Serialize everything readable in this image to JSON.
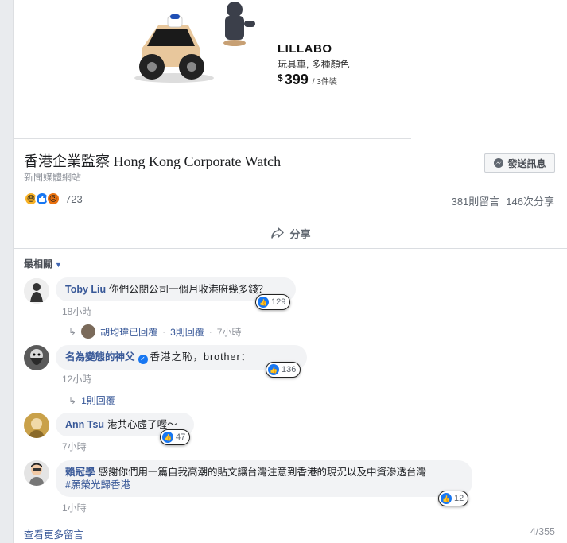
{
  "product": {
    "name": "LILLABO",
    "description": "玩具車, 多種顏色",
    "currency": "$",
    "price": "399",
    "unit": "/ 3件裝"
  },
  "page": {
    "name": "香港企業監察 Hong Kong Corporate Watch",
    "category": "新聞媒體網站",
    "message_button": "發送訊息"
  },
  "reactions": {
    "count": "723",
    "types": [
      "haha",
      "like",
      "angry"
    ]
  },
  "stats": {
    "comments": "381則留言",
    "shares": "146次分享"
  },
  "actions": {
    "share": "分享"
  },
  "comments_header": {
    "sort": "最相關"
  },
  "comments": [
    {
      "author": "Toby Liu",
      "text": "你們公關公司一個月收港府幾多錢？",
      "likes": "129",
      "time": "18小時",
      "reply_author": "胡均瑋已回覆",
      "reply_count": "3則回覆",
      "reply_time": "7小時"
    },
    {
      "author": "名為變態的神父",
      "text": "香港之恥，brother：",
      "likes": "136",
      "time": "12小時",
      "reply_count": "1則回覆"
    },
    {
      "author": "Ann Tsu",
      "text": "港共心虛了喔～",
      "likes": "47",
      "time": "7小時"
    },
    {
      "author": "賴冠學",
      "text": "感謝你們用一篇自我高潮的貼文讓台灣注意到香港的現況以及中資滲透台灣",
      "hashtag": "#願榮光歸香港",
      "likes": "12",
      "time": "1小時"
    }
  ],
  "footer": {
    "view_more": "查看更多留言",
    "pager": "4/355"
  },
  "colors": {
    "link": "#385898",
    "accent": "#1877f2",
    "bubble": "#f2f3f5"
  }
}
